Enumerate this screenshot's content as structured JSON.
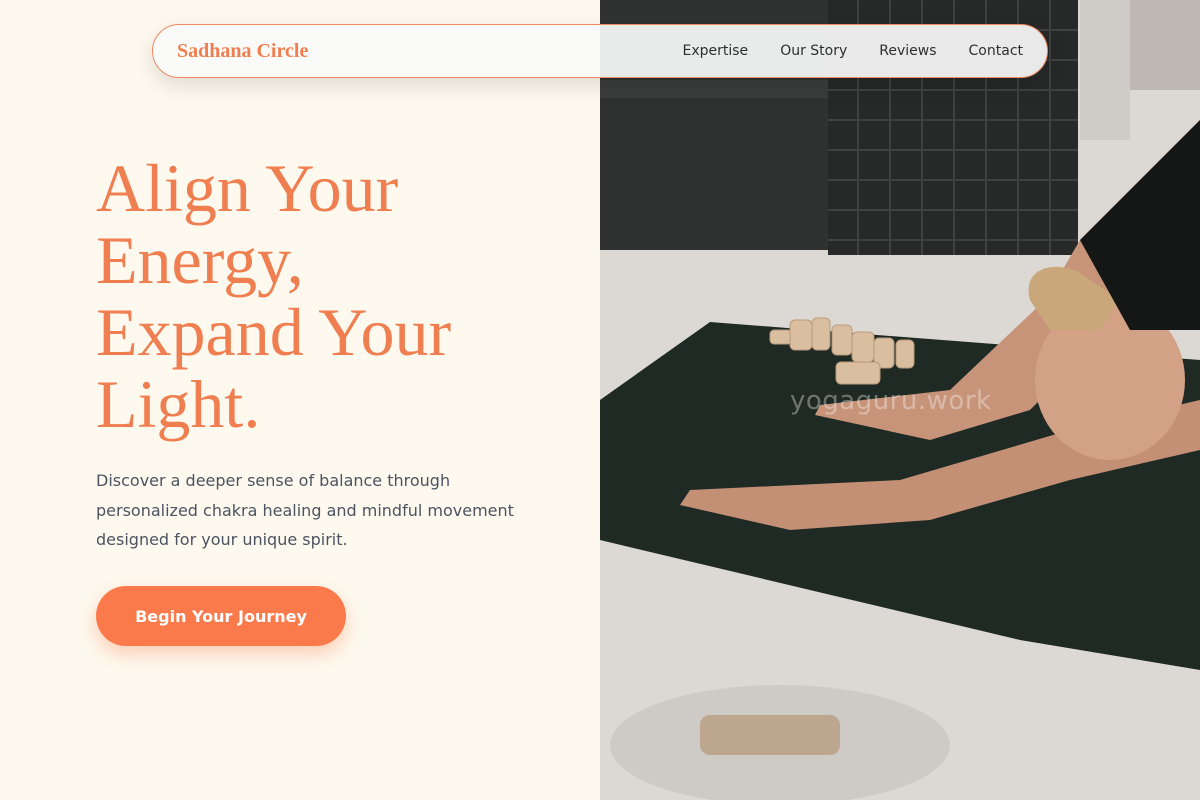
{
  "nav": {
    "brand": "Sadhana Circle",
    "links": [
      "Expertise",
      "Our Story",
      "Reviews",
      "Contact"
    ]
  },
  "hero": {
    "title_lines": [
      "Align Your",
      "Energy,",
      "Expand Your",
      "Light."
    ],
    "subtitle": "Discover a deeper sense of balance through personalized chakra healing and mindful movement designed for your unique spirit.",
    "cta_label": "Begin Your Journey"
  },
  "photo": {
    "watermark": "yogaguru.work"
  },
  "colors": {
    "accent": "#ef7f50",
    "button": "#fb7a4c",
    "background": "#fdf9ee",
    "body_text": "#4c5361"
  }
}
